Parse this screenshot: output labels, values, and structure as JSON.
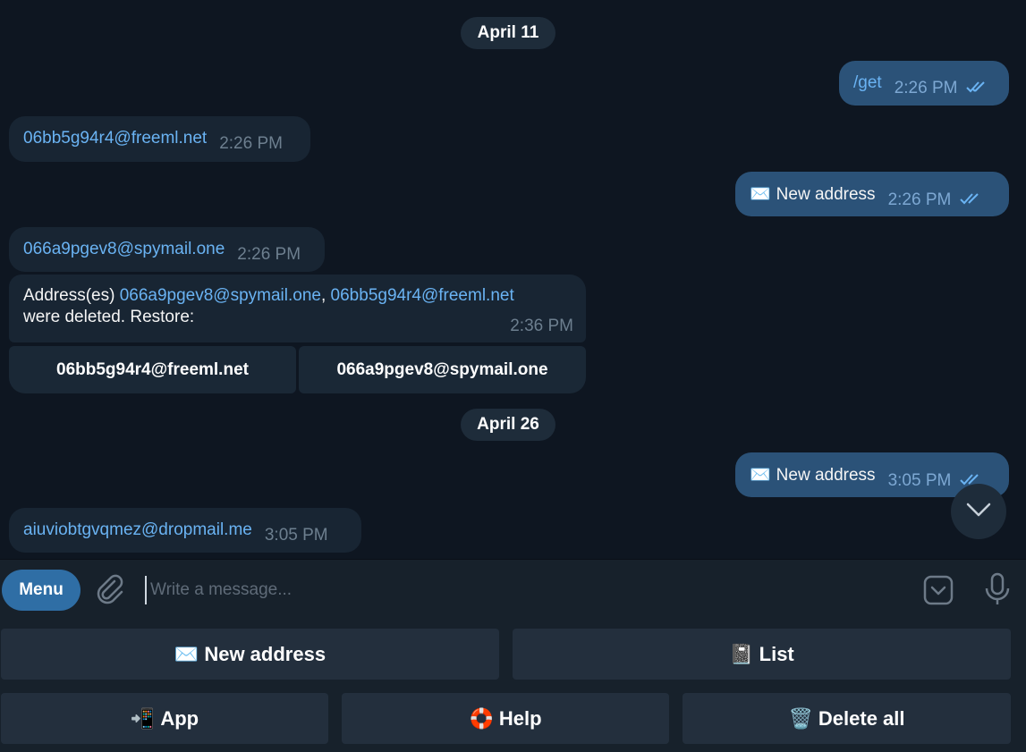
{
  "dates": {
    "first": "April 11",
    "second": "April 26"
  },
  "messages": [
    {
      "dir": "out",
      "text": "/get",
      "time": "2:26 PM"
    },
    {
      "dir": "in",
      "text": "06bb5g94r4@freeml.net",
      "time": "2:26 PM"
    },
    {
      "dir": "out",
      "emoji": "✉️",
      "text": "New address",
      "time": "2:26 PM"
    },
    {
      "dir": "in",
      "text": "066a9pgev8@spymail.one",
      "time": "2:26 PM"
    },
    {
      "dir": "in",
      "prefix": "Address(es) ",
      "link1": "066a9pgev8@spymail.one",
      "sep": ", ",
      "link2": "06bb5g94r4@freeml.net",
      "suffix": "were deleted. Restore:",
      "time": "2:36 PM"
    },
    {
      "dir": "out",
      "emoji": "✉️",
      "text": "New address",
      "time": "3:05 PM"
    },
    {
      "dir": "in",
      "text": "aiuviobtgvqmez@dropmail.me",
      "time": "3:05 PM"
    }
  ],
  "inline_buttons": [
    "06bb5g94r4@freeml.net",
    "066a9pgev8@spymail.one"
  ],
  "composer": {
    "menu_label": "Menu",
    "placeholder": "Write a message..."
  },
  "keyboard": {
    "row1": [
      {
        "emoji": "✉️",
        "label": "New address"
      },
      {
        "emoji": "📓",
        "label": "List"
      }
    ],
    "row2": [
      {
        "emoji": "📲",
        "label": "App"
      },
      {
        "emoji": "🛟",
        "label": "Help"
      },
      {
        "emoji": "🗑️",
        "label": "Delete all"
      }
    ]
  },
  "icons": [
    "attach-icon",
    "emoji-sticker-icon",
    "microphone-icon",
    "chevron-down-icon",
    "double-check-icon"
  ],
  "colors": {
    "background": "#0e1621",
    "incoming": "#182533",
    "outgoing": "#2b5278",
    "link": "#6ab3f3",
    "accent": "#2f6ea5"
  }
}
